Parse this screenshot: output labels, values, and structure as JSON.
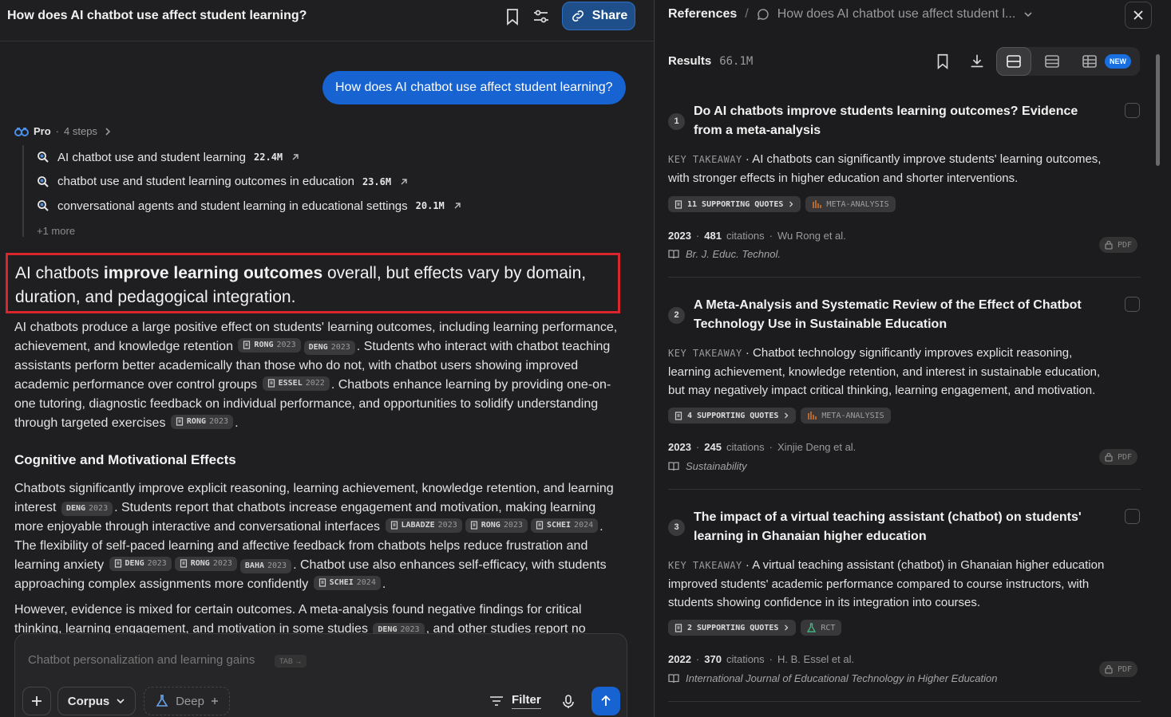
{
  "thread": {
    "title": "How does AI chatbot use affect student learning?",
    "share_label": "Share",
    "user_question": "How does AI chatbot use affect student learning?"
  },
  "pro": {
    "label": "Pro",
    "steps_label": "4 steps",
    "steps": [
      {
        "query": "AI chatbot use and student learning",
        "count": "22.4M"
      },
      {
        "query": "chatbot use and student learning outcomes in education",
        "count": "23.6M"
      },
      {
        "query": "conversational agents and student learning in educational settings",
        "count": "20.1M"
      }
    ],
    "more_label": "+1 more"
  },
  "answer": {
    "headline_pre": "AI chatbots ",
    "headline_bold": "improve learning outcomes",
    "headline_post": " overall, but effects vary by domain, duration, and pedagogical integration.",
    "p1": {
      "t1": "AI chatbots produce a large positive effect on students' learning outcomes, including learning performance, achievement, and knowledge retention",
      "t2": ". Students who interact with chatbot teaching assistants perform better academically than those who do not, with chatbot users showing improved academic performance over control groups",
      "t3": ". Chatbots enhance learning by providing one-on-one tutoring, diagnostic feedback on individual performance, and opportunities to solidify understanding through targeted exercises",
      "t4": "."
    },
    "section_title": "Cognitive and Motivational Effects",
    "p2": {
      "t1": "Chatbots significantly improve explicit reasoning, learning achievement, knowledge retention, and learning interest",
      "t2": ". Students report that chatbots increase engagement and motivation, making learning more enjoyable through interactive and conversational interfaces",
      "t3": ". The flexibility of self-paced learning and affective feedback from chatbots helps reduce frustration and learning anxiety",
      "t4": ". Chatbot use also enhances self-efficacy, with students approaching complex assignments more confidently",
      "t5": "."
    },
    "p3": {
      "t1": "However, evidence is mixed for certain outcomes. A meta-analysis found negative findings for critical thinking, learning engagement, and motivation in some studies",
      "t2": ", and other studies report no"
    },
    "citations": {
      "rong": {
        "name": "RONG",
        "year": "2023"
      },
      "deng": {
        "name": "DENG",
        "year": "2023"
      },
      "essel": {
        "name": "ESSEL",
        "year": "2022"
      },
      "labadze": {
        "name": "LABADZE",
        "year": "2023"
      },
      "schei": {
        "name": "SCHEI",
        "year": "2024"
      },
      "baha": {
        "name": "BAHA",
        "year": "2023"
      }
    }
  },
  "input": {
    "placeholder": "Chatbot personalization and learning gains",
    "tab_hint": "TAB →",
    "corpus_label": "Corpus",
    "deep_label": "Deep",
    "filter_label": "Filter"
  },
  "references": {
    "title": "References",
    "thread_title": "How does AI chatbot use affect student l...",
    "results_label": "Results",
    "results_count": "66.1M",
    "new_badge": "NEW",
    "takeaway_label": "KEY TAKEAWAY",
    "citations_label": "citations",
    "pdf_label": "PDF",
    "items": [
      {
        "num": "1",
        "title": "Do AI chatbots improve students learning outcomes? Evidence from a meta-analysis",
        "takeaway": "AI chatbots can significantly improve students' learning outcomes, with stronger effects in higher education and shorter interventions.",
        "quotes": "11 SUPPORTING QUOTES",
        "study": "META-ANALYSIS",
        "year": "2023",
        "citations": "481",
        "authors": "Wu Rong et al.",
        "journal": "Br. J. Educ. Technol."
      },
      {
        "num": "2",
        "title": "A Meta-Analysis and Systematic Review of the Effect of Chatbot Technology Use in Sustainable Education",
        "takeaway": "Chatbot technology significantly improves explicit reasoning, learning achievement, knowledge retention, and interest in sustainable education, but may negatively impact critical thinking, learning engagement, and motivation.",
        "quotes": "4 SUPPORTING QUOTES",
        "study": "META-ANALYSIS",
        "year": "2023",
        "citations": "245",
        "authors": "Xinjie Deng et al.",
        "journal": "Sustainability"
      },
      {
        "num": "3",
        "title": "The impact of a virtual teaching assistant (chatbot) on students' learning in Ghanaian higher education",
        "takeaway": "A virtual teaching assistant (chatbot) in Ghanaian higher education improved students' academic performance compared to course instructors, with students showing confidence in its integration into courses.",
        "quotes": "2 SUPPORTING QUOTES",
        "study": "RCT",
        "year": "2022",
        "citations": "370",
        "authors": "H. B. Essel et al.",
        "journal": "International Journal of Educational Technology in Higher Education"
      }
    ]
  },
  "colors": {
    "accent": "#1663d1",
    "highlight_border": "#d9262c",
    "meta_analysis": "#d9772b",
    "rct": "#3fb27f"
  }
}
